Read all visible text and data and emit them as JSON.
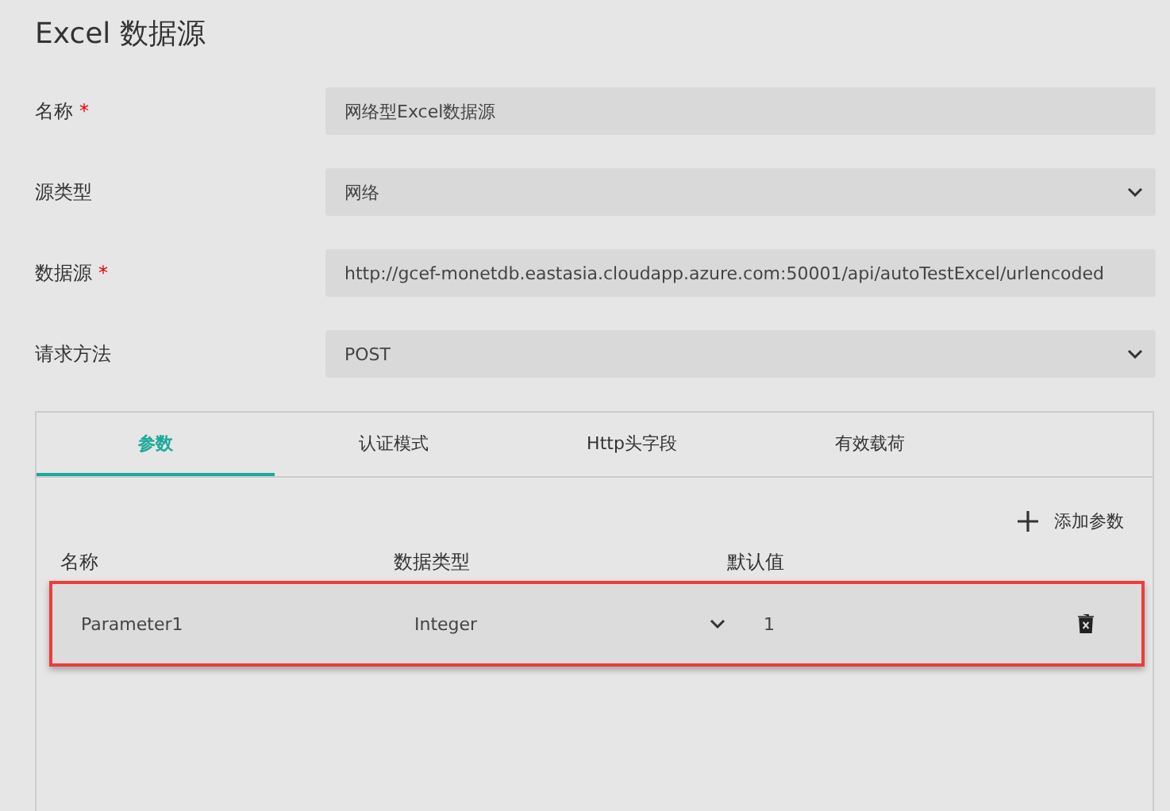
{
  "title": "Excel 数据源",
  "fields": [
    {
      "label": "名称",
      "required": true,
      "kind": "text",
      "value": "网络型Excel数据源"
    },
    {
      "label": "源类型",
      "required": false,
      "kind": "select",
      "value": "网络"
    },
    {
      "label": "数据源",
      "required": true,
      "kind": "text",
      "value": "http://gcef-monetdb.eastasia.cloudapp.azure.com:50001/api/autoTestExcel/urlencoded"
    },
    {
      "label": "请求方法",
      "required": false,
      "kind": "select",
      "value": "POST"
    }
  ],
  "required_mark": "*",
  "tabs": [
    {
      "label": "参数",
      "selected": true
    },
    {
      "label": "认证模式",
      "selected": false
    },
    {
      "label": "Http头字段",
      "selected": false
    },
    {
      "label": "有效载荷",
      "selected": false
    }
  ],
  "add_button": "添加参数",
  "columns": [
    "名称",
    "数据类型",
    "默认值"
  ],
  "rows": [
    {
      "name": "Parameter1",
      "type": "Integer",
      "default": "1",
      "highlighted": true
    }
  ]
}
